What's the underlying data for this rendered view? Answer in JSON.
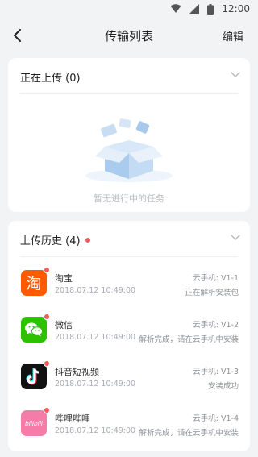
{
  "status_bar": {
    "time": "12:00",
    "icons": [
      "wifi-icon",
      "signal-icon",
      "battery-icon"
    ]
  },
  "nav": {
    "title": "传输列表",
    "edit_label": "编辑",
    "back_icon": "back-arrow-icon"
  },
  "uploading": {
    "title": "正在上传 (0)",
    "empty_text": "暂无进行中的任务",
    "illustration": "open-box-icon"
  },
  "history": {
    "title": "上传历史 (4)",
    "items": [
      {
        "name": "淘宝",
        "time": "2018.07.12  10:49:00",
        "device": "云手机: V1-1",
        "status": "正在解析安装包",
        "icon": "taobao-icon",
        "icon_glyph": "淘",
        "icon_color": "#ff5a00"
      },
      {
        "name": "微信",
        "time": "2018.07.12  10:49:00",
        "device": "云手机: V1-2",
        "status": "解析完成，请在云手机中安装",
        "icon": "wechat-icon",
        "icon_color": "#2dc100"
      },
      {
        "name": "抖音短视频",
        "time": "2018.07.12  10:49:00",
        "device": "云手机: V1-3",
        "status": "安装成功",
        "icon": "douyin-icon",
        "icon_color": "#111111"
      },
      {
        "name": "哔哩哔哩",
        "time": "2018.07.12  10:49:00",
        "device": "云手机: V1-4",
        "status": "解析完成，请在云手机中安装",
        "icon": "bilibili-icon",
        "icon_glyph": "bilibili",
        "icon_color": "#f47ca6"
      }
    ]
  }
}
